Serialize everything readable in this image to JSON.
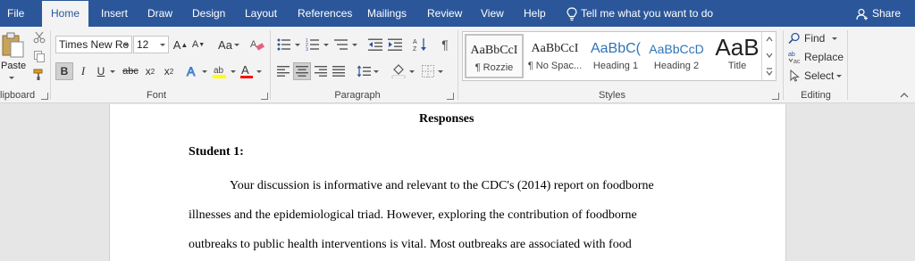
{
  "tabs": {
    "file": "File",
    "home": "Home",
    "insert": "Insert",
    "draw": "Draw",
    "design": "Design",
    "layout": "Layout",
    "references": "References",
    "mailings": "Mailings",
    "review": "Review",
    "view": "View",
    "help": "Help"
  },
  "tell_me": "Tell me what you want to do",
  "share": "Share",
  "clipboard": {
    "paste": "Paste",
    "label": "lipboard"
  },
  "font": {
    "name": "Times New Ro",
    "size": "12",
    "grow": "A",
    "shrink": "A",
    "case": "Aa",
    "bold": "B",
    "italic": "I",
    "underline": "U",
    "strike": "abc",
    "subscript": "x",
    "superscript": "x",
    "label": "Font"
  },
  "paragraph": {
    "label": "Paragraph",
    "show_marks": "¶"
  },
  "styles": {
    "label": "Styles",
    "items": [
      {
        "preview": "AaBbCcI",
        "name": "¶ Rozzie"
      },
      {
        "preview": "AaBbCcI",
        "name": "¶ No Spac..."
      },
      {
        "preview": "AaBbC(",
        "name": "Heading 1"
      },
      {
        "preview": "AaBbCcD",
        "name": "Heading 2"
      },
      {
        "preview": "AaB",
        "name": "Title"
      }
    ]
  },
  "editing": {
    "find": "Find",
    "replace": "Replace",
    "select": "Select",
    "label": "Editing"
  },
  "document": {
    "title": "Responses",
    "student_heading": "Student 1:",
    "lines": [
      "Your discussion is informative and relevant to the CDC's (2014) report on foodborne",
      "illnesses and the epidemiological triad. However, exploring the contribution of foodborne",
      "outbreaks to public health interventions is vital. Most outbreaks are associated with food"
    ]
  },
  "colors": {
    "ribbon_blue": "#2b579a",
    "highlight_yellow": "#ffff00",
    "font_red": "#ff0000",
    "heading_blue": "#2e74b5"
  }
}
